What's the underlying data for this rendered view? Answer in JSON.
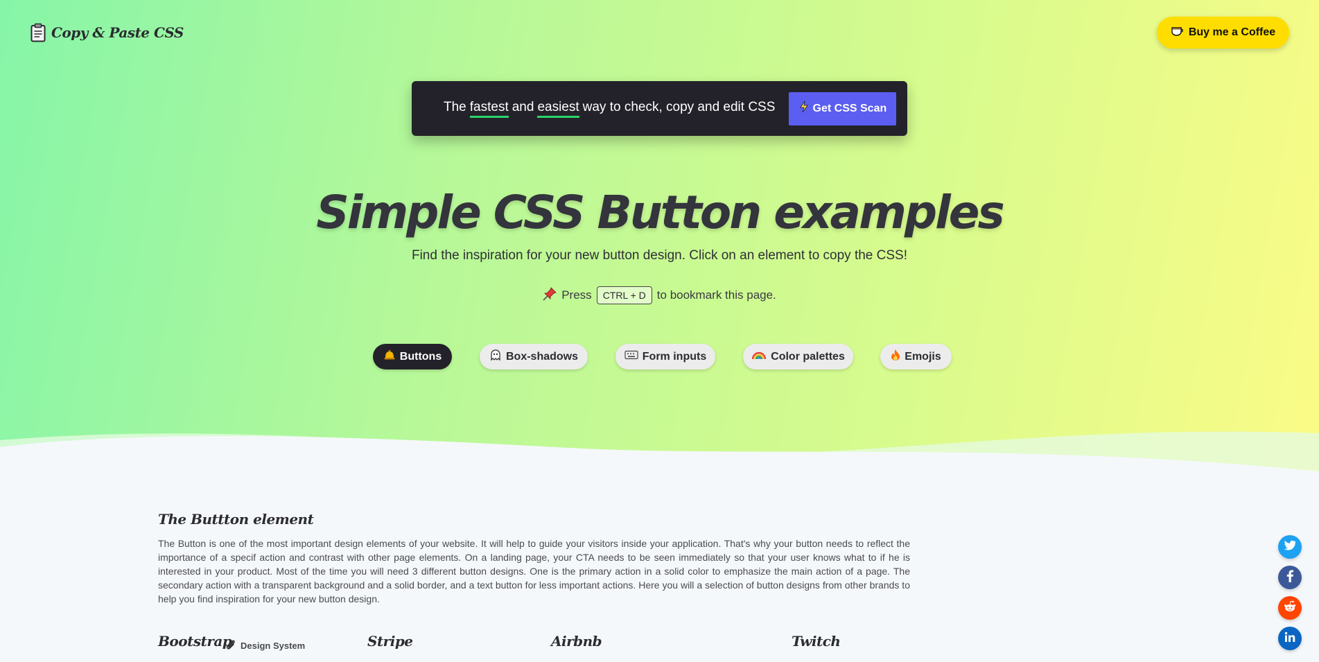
{
  "header": {
    "logo_text": "Copy & Paste CSS",
    "coffee_label": "Buy me a Coffee"
  },
  "promo": {
    "text_1": "The",
    "text_fastest": "fastest",
    "text_and": "and",
    "text_easiest": "easiest",
    "text_rest": "way to check, copy and edit CSS",
    "button_label": "Get CSS Scan"
  },
  "hero": {
    "title": "Simple CSS Button examples",
    "subtitle": "Find the inspiration for your new button design. Click on an element to copy the CSS!",
    "bookmark_press": "Press",
    "bookmark_keys": "CTRL + D",
    "bookmark_rest": "to bookmark this page."
  },
  "tabs": [
    {
      "label": "Buttons",
      "icon": "bell-icon",
      "active": true
    },
    {
      "label": "Box-shadows",
      "icon": "ghost-icon",
      "active": false
    },
    {
      "label": "Form inputs",
      "icon": "keyboard-icon",
      "active": false
    },
    {
      "label": "Color palettes",
      "icon": "rainbow-icon",
      "active": false
    },
    {
      "label": "Emojis",
      "icon": "fire-icon",
      "active": false
    }
  ],
  "section": {
    "title": "The Buttton element",
    "body": "The Button is one of the most important design elements of your website. It will help to guide your visitors inside your application. That's why your button needs to reflect the importance of a specif action and contrast with other page elements. On a landing page, your CTA needs to be seen immediately so that your user knows what to if he is interested in your product. Most of the time you will need 3 different button designs. One is the primary action in a solid color to emphasize the main action of a page. The secondary action with a transparent background and a solid border, and a text button for less important actions. Here you will a selection of button designs from other brands to help you find inspiration for your new button design."
  },
  "brands": {
    "bootstrap": "Bootstrap",
    "design_system": "Design System",
    "stripe": "Stripe",
    "airbnb": "Airbnb",
    "twitch": "Twitch"
  },
  "social": [
    {
      "name": "twitter-icon",
      "color": "#1da1f2"
    },
    {
      "name": "facebook-icon",
      "color": "#3b5998"
    },
    {
      "name": "reddit-icon",
      "color": "#ff4500"
    },
    {
      "name": "linkedin-icon",
      "color": "#0a66c2"
    }
  ],
  "colors": {
    "accent": "#5b5ef0",
    "coffee": "#ffdd00",
    "dark": "#23222a",
    "underline": "#2ad46a"
  }
}
